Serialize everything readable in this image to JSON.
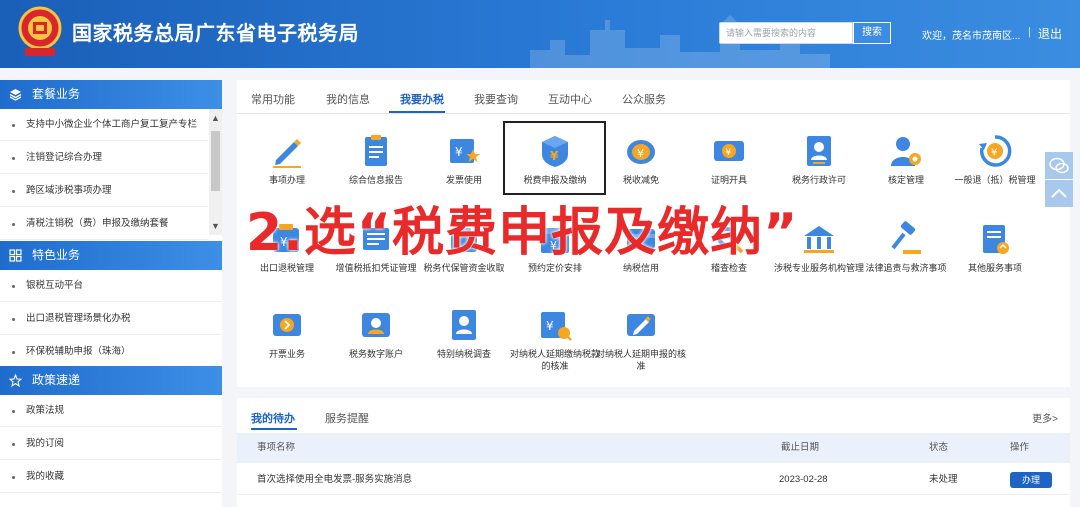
{
  "header": {
    "title": "国家税务总局广东省电子税务局",
    "search_placeholder": "请输入需要搜索的内容",
    "search_button": "搜索",
    "welcome": "欢迎，茂名市茂南区...",
    "separator": "|",
    "logout": "退出"
  },
  "sidebar": {
    "sections": [
      {
        "title": "套餐业务",
        "icon": "layers-icon",
        "items": [
          "支持中小微企业个体工商户复工复产专栏",
          "注销登记综合办理",
          "跨区域涉税事项办理",
          "清税注销税（费）申报及缴纳套餐"
        ]
      },
      {
        "title": "特色业务",
        "icon": "grid-icon",
        "items": [
          "银税互动平台",
          "出口退税管理场景化办税",
          "环保税辅助申报（珠海）"
        ]
      },
      {
        "title": "政策速递",
        "icon": "star-icon",
        "items": [
          "政策法规",
          "我的订阅",
          "我的收藏"
        ]
      }
    ]
  },
  "tabs": [
    "常用功能",
    "我的信息",
    "我要办税",
    "我要查询",
    "互动中心",
    "公众服务"
  ],
  "active_tab": "我要办税",
  "services": [
    {
      "label": "事项办理",
      "icon": "pencil-icon"
    },
    {
      "label": "综合信息报告",
      "icon": "document-list-icon"
    },
    {
      "label": "发票使用",
      "icon": "invoice-star-icon"
    },
    {
      "label": "税费申报及缴纳",
      "icon": "tax-declare-shield-icon"
    },
    {
      "label": "税收减免",
      "icon": "coin-reduce-icon"
    },
    {
      "label": "证明开具",
      "icon": "certificate-icon"
    },
    {
      "label": "税务行政许可",
      "icon": "id-badge-icon"
    },
    {
      "label": "核定管理",
      "icon": "person-gear-icon"
    },
    {
      "label": "一般退（抵）税管理",
      "icon": "refund-cycle-icon"
    },
    {
      "label": "出口退税管理",
      "icon": "export-refund-icon"
    },
    {
      "label": "增值税抵扣凭证管理",
      "icon": "voucher-icon"
    },
    {
      "label": "税务代保管资金收取",
      "icon": "fund-icon"
    },
    {
      "label": "预约定价安排",
      "icon": "calendar-price-icon"
    },
    {
      "label": "纳税信用",
      "icon": "credit-icon"
    },
    {
      "label": "稽查检查",
      "icon": "inspect-icon"
    },
    {
      "label": "涉税专业服务机构管理",
      "icon": "agency-icon"
    },
    {
      "label": "法律追责与救济事项",
      "icon": "gavel-icon"
    },
    {
      "label": "其他服务事项",
      "icon": "other-service-icon"
    },
    {
      "label": "开票业务",
      "icon": "issue-invoice-icon"
    },
    {
      "label": "税务数字账户",
      "icon": "digital-account-icon"
    },
    {
      "label": "特别纳税调查",
      "icon": "special-investigation-icon"
    },
    {
      "label": "对纳税人延期缴纳税款的核准",
      "icon": "delay-payment-icon"
    },
    {
      "label": "对纳税人延期申报的核准",
      "icon": "delay-declare-icon"
    }
  ],
  "annotation": "2.选“税费申报及缴纳”",
  "todo": {
    "tabs": [
      "我的待办",
      "服务提醒"
    ],
    "more": "更多>",
    "columns": [
      "事项名称",
      "截止日期",
      "状态",
      "操作"
    ],
    "rows": [
      {
        "name": "首次选择使用全电发票-服务实施消息",
        "deadline": "2023-02-28",
        "status": "未处理",
        "action": "办理"
      }
    ]
  },
  "colors": {
    "primary": "#1d64c4",
    "header": "#2a7bd6",
    "annotation": "#e82a2a",
    "icon_blue": "#3d87e0",
    "icon_orange": "#f5a623"
  }
}
